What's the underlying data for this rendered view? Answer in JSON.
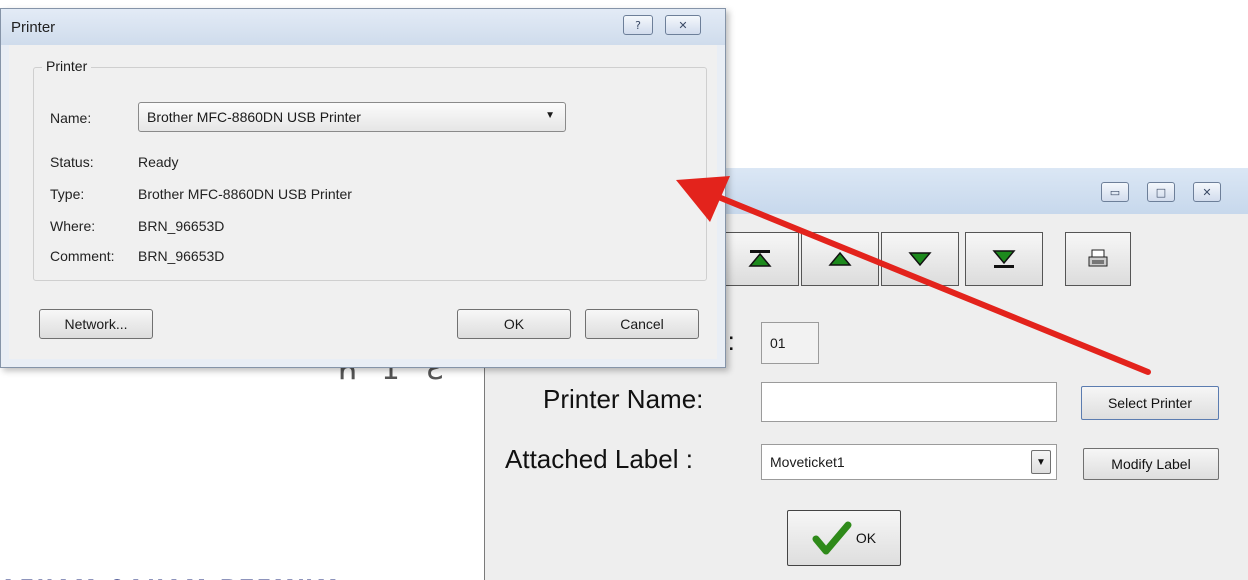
{
  "printer_dialog": {
    "title": "Printer",
    "help_button": "?",
    "close_button": "✕",
    "group_label": "Printer",
    "name_label": "Name:",
    "name_value": "Brother MFC-8860DN USB Printer",
    "status_label": "Status:",
    "status_value": "Ready",
    "type_label": "Type:",
    "type_value": "Brother MFC-8860DN USB Printer",
    "where_label": "Where:",
    "where_value": "BRN_96653D",
    "comment_label": "Comment:",
    "comment_value": "BRN_96653D",
    "network_button": "Network...",
    "ok_button": "OK",
    "cancel_button": "Cancel"
  },
  "config_window": {
    "id_label_suffix": "):",
    "id_value": "01",
    "printer_name_label": "Printer Name:",
    "printer_name_value": "",
    "select_printer_button": "Select Printer",
    "attached_label_label": "Attached Label :",
    "attached_label_value": "Moveticket1",
    "modify_label_button": "Modify Label",
    "ok_button": "OK"
  },
  "background": {
    "glyphs": "ЋIƧ",
    "bottom_text": "ᴀᴇᴋᴀᴍ ᴄᴀᴋᴀᴍ ᴘᴛᴇᴍᴜᴍ"
  },
  "colors": {
    "arrow": "#e3231c",
    "nav_icon": "#1d8a1d",
    "ok_check": "#2f8a1a"
  }
}
